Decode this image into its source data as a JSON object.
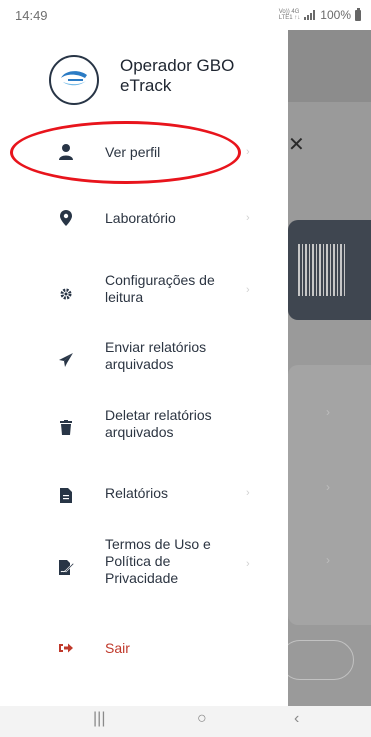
{
  "status_bar": {
    "time": "14:49",
    "network_top": "Vo)) 4G",
    "network_bottom": "LTE1 ↑↓",
    "battery_text": "100%"
  },
  "app": {
    "title": "Operador GBO eTrack",
    "logo_icon": "etrack-logo-icon"
  },
  "menu": {
    "items": [
      {
        "label": "Ver perfil",
        "icon": "user-icon",
        "color": "#2c3542"
      },
      {
        "label": "Laboratório",
        "icon": "map-marker-icon",
        "color": "#2c3542"
      },
      {
        "label": "Configurações de leitura",
        "icon": "gear-icon",
        "color": "#2c3542"
      },
      {
        "label": "Enviar relatórios arquivados",
        "icon": "paper-plane-icon",
        "color": "#2c3542"
      },
      {
        "label": "Deletar relatórios arquivados",
        "icon": "trash-icon",
        "color": "#2c3542"
      },
      {
        "label": "Relatórios",
        "icon": "file-icon",
        "color": "#2c3542"
      },
      {
        "label": "Termos de Uso e Política de Privacidade",
        "icon": "file-signature-icon",
        "color": "#2c3542"
      },
      {
        "label": "Sair",
        "icon": "sign-out-icon",
        "color": "#c0392b"
      }
    ],
    "chevron": "›"
  },
  "nav_bar": {
    "recents": "|||",
    "home": "○",
    "back": "‹"
  },
  "colors": {
    "accent": "#283546",
    "danger": "#c0392b",
    "annotation": "#e8141c",
    "scrim": "#9a9a9a"
  }
}
